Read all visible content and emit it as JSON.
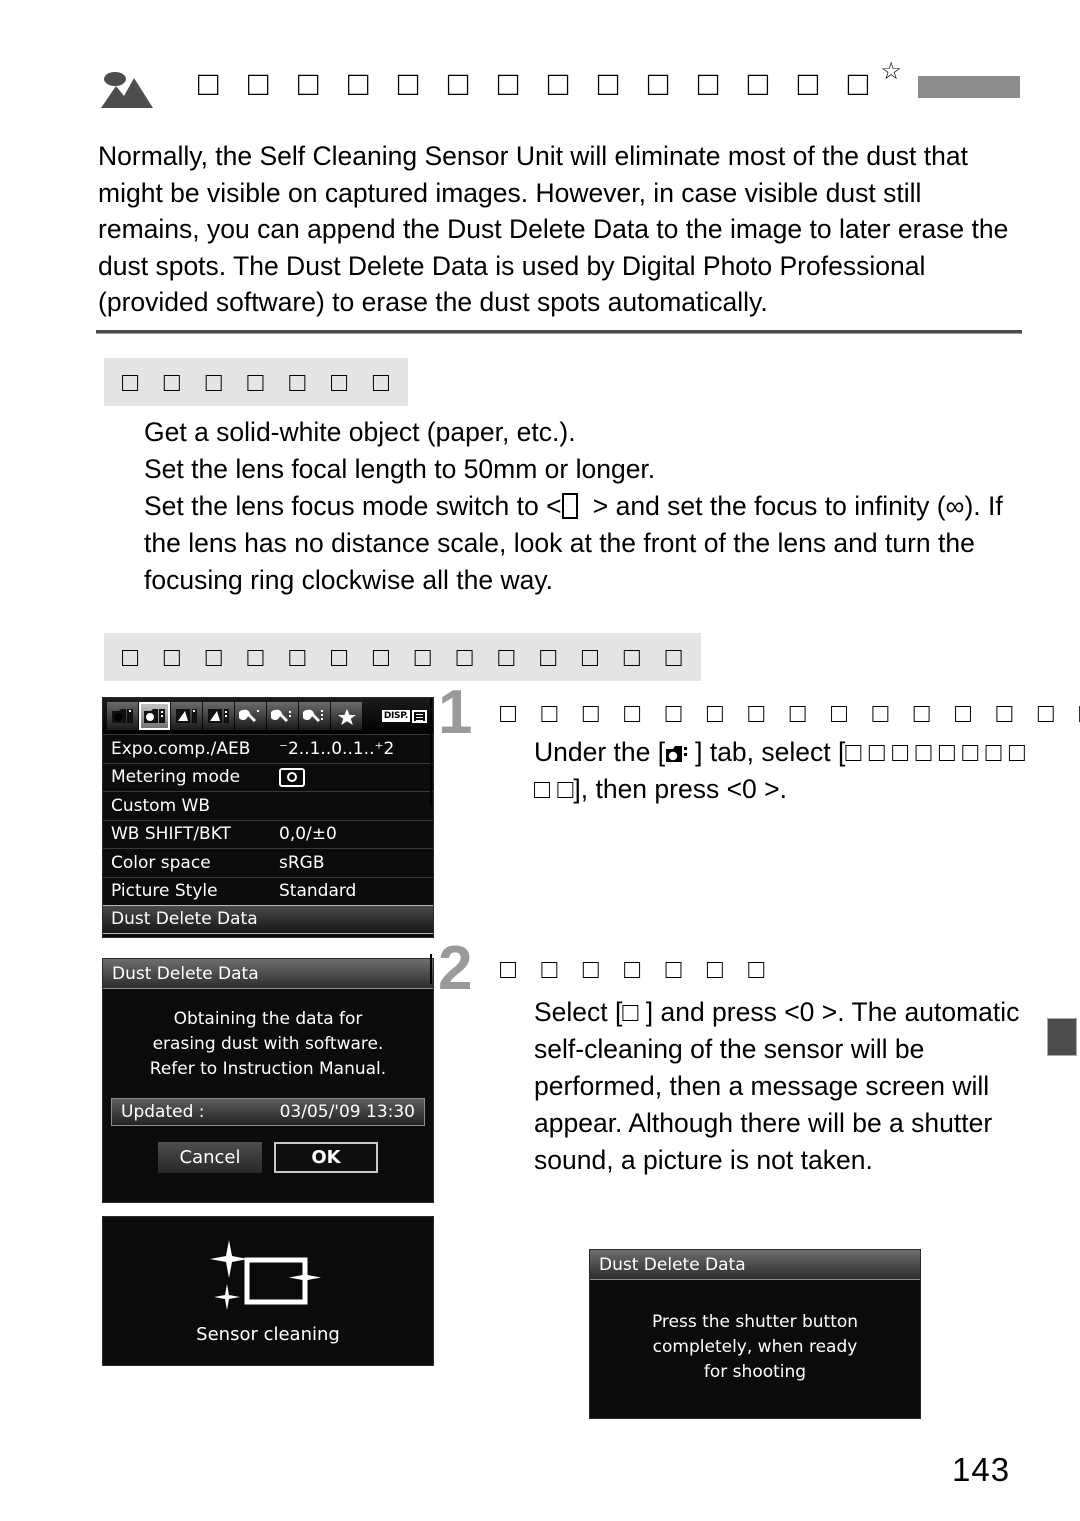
{
  "page": {
    "number": "143",
    "title_icon": "landscape-mountain-icon",
    "title_text": "□ □ □ □ □ □ □ □ □ □ □ □ □ □",
    "title_star": "☆",
    "intro": "Normally, the Self Cleaning Sensor Unit will eliminate most of the dust that might be visible on captured images. However, in case visible dust still remains, you can append the Dust Delete Data to the image to later erase the dust spots. The Dust Delete Data is used by Digital Photo Professional (provided software) to erase the dust spots automatically."
  },
  "preparation": {
    "banner": "□ □ □ □ □ □ □",
    "line_1": "Get a solid-white object (paper, etc.).",
    "line_2": "Set the lens focal length to 50mm or longer.",
    "line_3_before": "Set the lens focus mode switch to <",
    "line_3_after": "> and set the focus to infinity (∞). If the lens has no distance scale, look at the front of the lens and turn the focusing ring clockwise all the way."
  },
  "procedure": {
    "banner": "□ □ □ □ □ □ □ □ □ □ □ □ □ □"
  },
  "steps": [
    {
      "number": "1",
      "heading": "□ □ □ □ □ □ □ □ □ □ □ □ □ □ □ □",
      "body_1": "Under the [",
      "body_2": "] tab, select [□ □ □ □ □ □ □ □ □ □], then press <0  >."
    },
    {
      "number": "2",
      "heading": "□ □ □ □ □ □ □",
      "body": "Select [□  ] and press <0  >. The automatic self-cleaning of the sensor will be performed, then a message screen will appear. Although there will be a shutter sound, a picture is not taken."
    }
  ],
  "menu_screen": {
    "tabs": [
      {
        "name": "shooting-1",
        "selected": false
      },
      {
        "name": "shooting-2",
        "selected": true
      },
      {
        "name": "playback-1",
        "selected": false
      },
      {
        "name": "playback-2",
        "selected": false
      },
      {
        "name": "setup-1",
        "selected": false
      },
      {
        "name": "setup-2",
        "selected": false
      },
      {
        "name": "setup-3",
        "selected": false
      },
      {
        "name": "my-menu",
        "selected": false
      }
    ],
    "disp_label": "DISP.",
    "rows": [
      {
        "label": "Expo.comp./AEB",
        "value": "⁻2..1..0..1..⁺2",
        "type": "scale",
        "highlighted": false
      },
      {
        "label": "Metering mode",
        "value": "",
        "type": "icon",
        "highlighted": false
      },
      {
        "label": "Custom WB",
        "value": "",
        "type": "text",
        "highlighted": false
      },
      {
        "label": "WB SHIFT/BKT",
        "value": "0,0/±0",
        "type": "text",
        "highlighted": false
      },
      {
        "label": "Color space",
        "value": "sRGB",
        "type": "text",
        "highlighted": false
      },
      {
        "label": "Picture Style",
        "value": "Standard",
        "type": "text",
        "highlighted": false
      },
      {
        "label": "Dust Delete Data",
        "value": "",
        "type": "text",
        "highlighted": true
      }
    ]
  },
  "dialog_screen": {
    "title": "Dust Delete Data",
    "message_line_1": "Obtaining the data for",
    "message_line_2": "erasing dust with software.",
    "message_line_3": "Refer to Instruction Manual.",
    "updated_label": "Updated :",
    "updated_value": "03/05/'09 13:30",
    "cancel_label": "Cancel",
    "ok_label": "OK"
  },
  "cleaning_screen": {
    "label": "Sensor cleaning",
    "icon": "sensor-sparkle-icon"
  },
  "shutter_screen": {
    "title": "Dust Delete Data",
    "message_line_1": "Press the shutter button",
    "message_line_2": "completely, when ready",
    "message_line_3": "for shooting"
  },
  "colors": {
    "title_bar": "#8c8c8c",
    "banner_bg": "#e4e4e4",
    "step_number": "#9a9a9a",
    "edge_tab": "#4d4d4d",
    "lcd_bg": "#0b0b0b"
  }
}
